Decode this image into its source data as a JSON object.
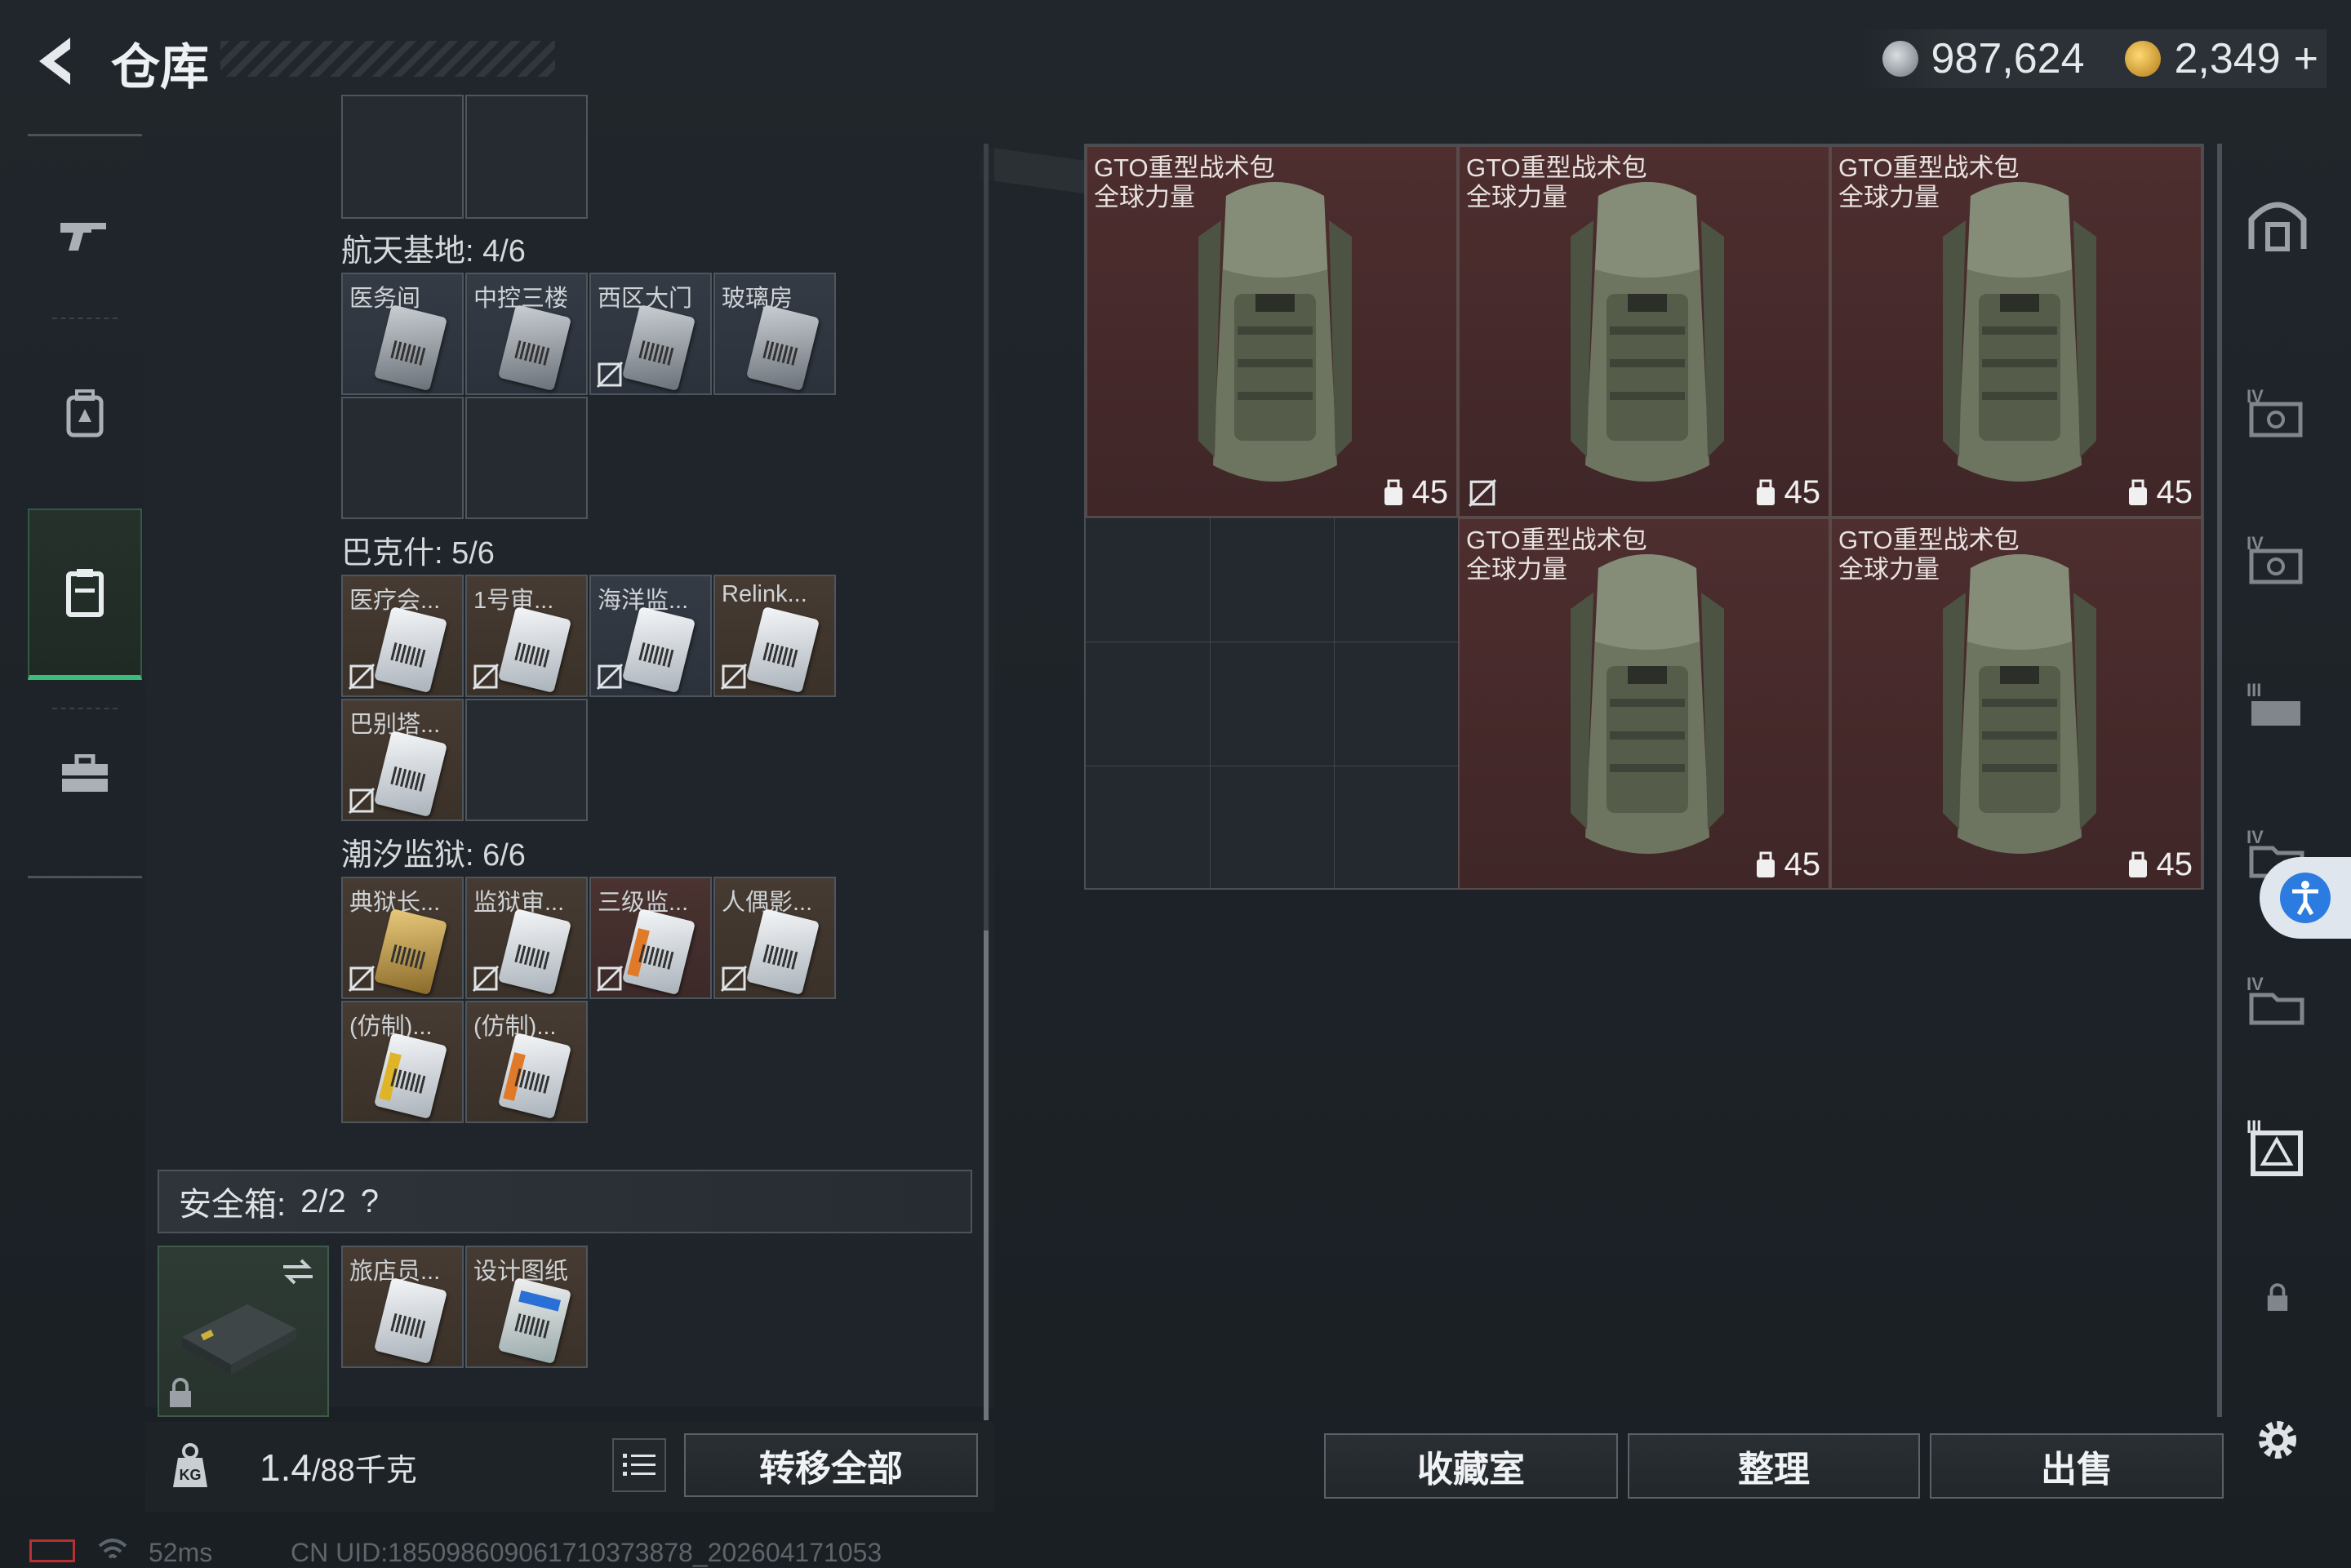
{
  "header": {
    "title": "仓库",
    "silver_amount": "987,624",
    "gold_amount": "2,349",
    "gold_plus": "+"
  },
  "left_nav": {
    "items": [
      "weapon-icon",
      "backpack-icon",
      "case-icon",
      "toolbox-icon"
    ],
    "active": "case-icon"
  },
  "sections": [
    {
      "title": "航天基地: 4/6",
      "items": [
        "医务间",
        "中控三楼",
        "西区大门",
        "玻璃房"
      ]
    },
    {
      "title": "巴克什: 5/6",
      "items": [
        "医疗会...",
        "1号审...",
        "海洋监...",
        "Relink...",
        "巴别塔..."
      ]
    },
    {
      "title": "潮汐监狱: 6/6",
      "items": [
        "典狱长...",
        "监狱审...",
        "三级监...",
        "人偶影...",
        "(仿制)...",
        "(仿制)..."
      ]
    }
  ],
  "safebox": {
    "title": "安全箱:",
    "count": "2/2",
    "help": "?",
    "items": [
      "旅店员...",
      "设计图纸"
    ]
  },
  "bottom": {
    "weight_current": "1.4",
    "weight_max": "/88千克",
    "transfer_all": "转移全部"
  },
  "bags": {
    "name_line1": "GTO重型战术包",
    "name_line2": "全球力量",
    "count": "45"
  },
  "actions": {
    "collection": "收藏室",
    "organize": "整理",
    "sell": "出售"
  },
  "footer": {
    "ping": "52ms",
    "uid": "CN UID:185098609061710373878_202604171053"
  },
  "colors": {
    "accent_green": "#3dbb7a",
    "bag_bg": "#4e2e2f",
    "access_blue": "#2b7be0"
  }
}
